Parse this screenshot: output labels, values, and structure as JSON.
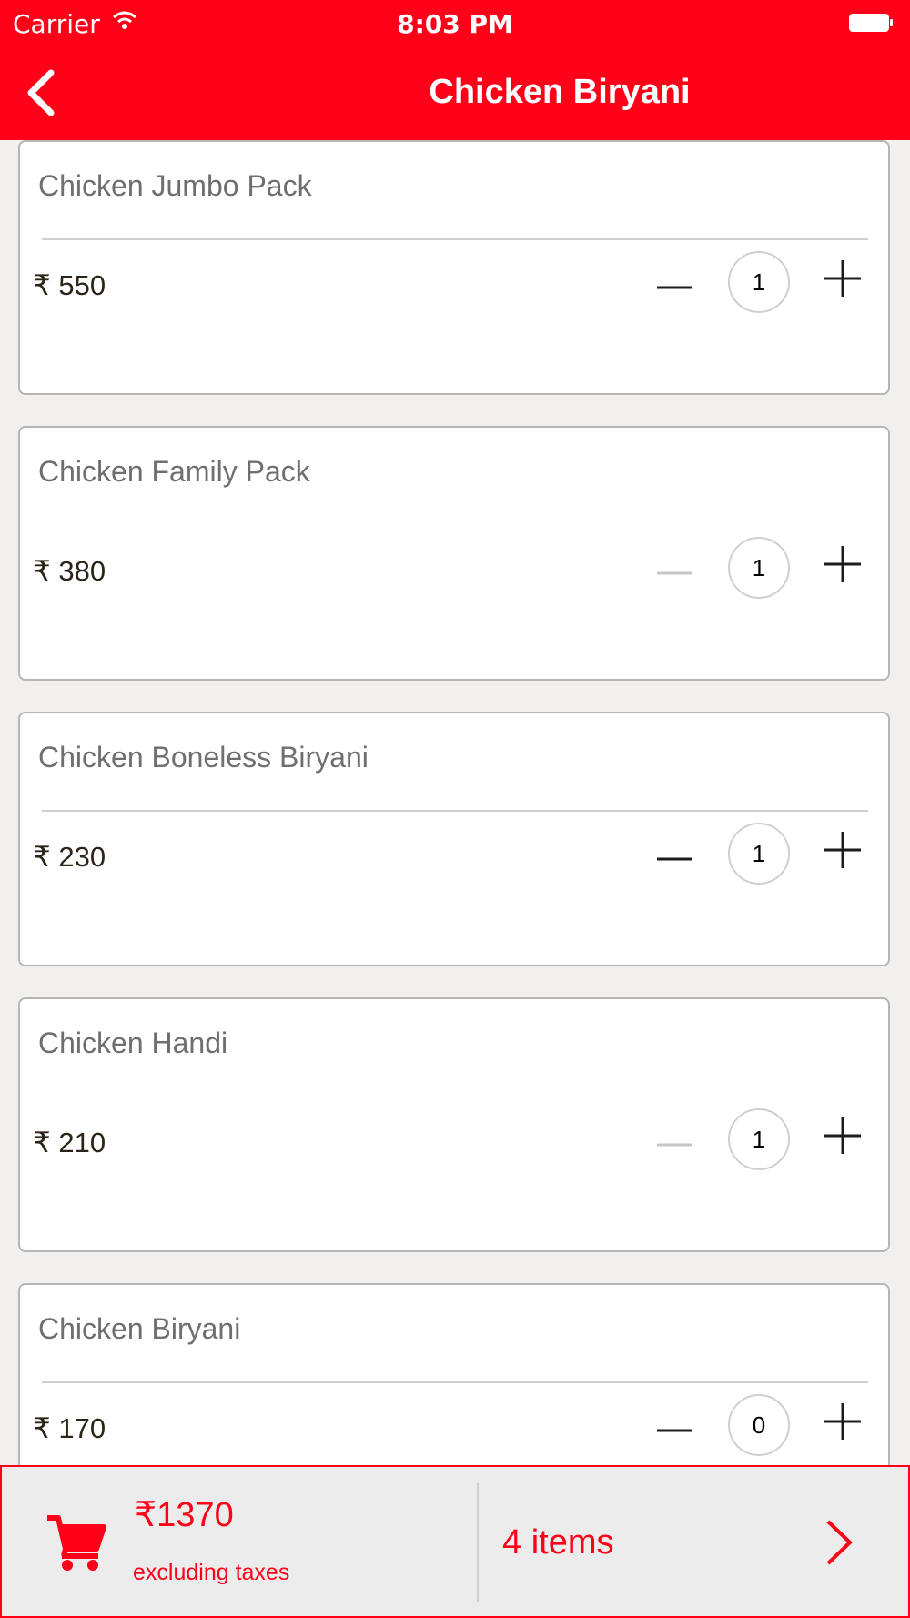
{
  "status_bar": {
    "carrier": "Carrier",
    "time": "8:03 PM"
  },
  "nav": {
    "title": "Chicken Biryani",
    "back_icon": "chevron-left-icon"
  },
  "items": [
    {
      "name": "Chicken Jumbo Pack",
      "price": "₹ 550",
      "qty": "1",
      "minus_enabled": true,
      "divider": true
    },
    {
      "name": "Chicken Family Pack",
      "price": "₹ 380",
      "qty": "1",
      "minus_enabled": false,
      "divider": false
    },
    {
      "name": "Chicken Boneless Biryani",
      "price": "₹ 230",
      "qty": "1",
      "minus_enabled": true,
      "divider": true
    },
    {
      "name": "Chicken Handi",
      "price": "₹ 210",
      "qty": "1",
      "minus_enabled": false,
      "divider": false
    },
    {
      "name": "Chicken Biryani",
      "price": "₹ 170",
      "qty": "0",
      "minus_enabled": true,
      "divider": true
    }
  ],
  "cart": {
    "total": "₹1370",
    "note": "excluding taxes",
    "items_label": "4 items",
    "cart_icon": "shopping-cart-icon",
    "arrow_icon": "chevron-right-icon"
  },
  "colors": {
    "accent": "#fe0017",
    "background": "#f1f0ef",
    "minus_disabled": "#c7c7c7",
    "minus_enabled": "#1c1c1c"
  }
}
